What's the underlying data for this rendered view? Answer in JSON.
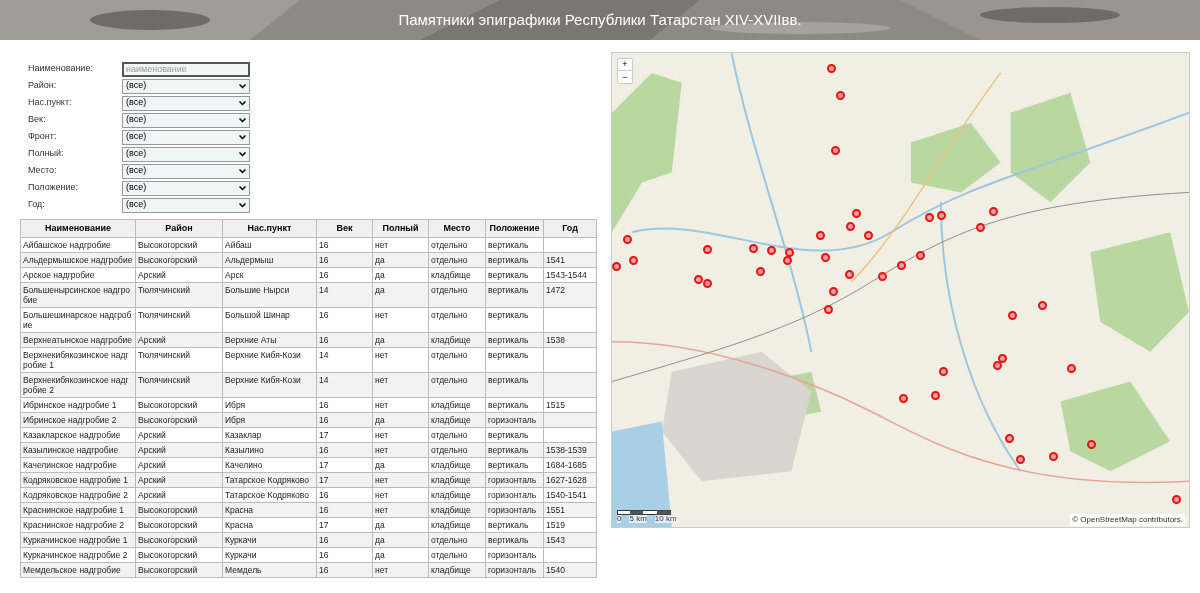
{
  "header": {
    "title": "Памятники эпиграфики Республики Татарстан XIV-XVIIвв."
  },
  "filters": [
    {
      "label": "Наименование:",
      "kind": "text",
      "placeholder": "наименование"
    },
    {
      "label": "Район:",
      "kind": "select",
      "value": "(все)"
    },
    {
      "label": "Нас.пункт:",
      "kind": "select",
      "value": "(все)"
    },
    {
      "label": "Век:",
      "kind": "select",
      "value": "(все)"
    },
    {
      "label": "Фронт:",
      "kind": "select",
      "value": "(все)"
    },
    {
      "label": "Полный:",
      "kind": "select",
      "value": "(все)"
    },
    {
      "label": "Место:",
      "kind": "select",
      "value": "(все)"
    },
    {
      "label": "Положение:",
      "kind": "select",
      "value": "(все)"
    },
    {
      "label": "Год:",
      "kind": "select",
      "value": "(все)"
    }
  ],
  "table": {
    "columns": [
      "Наименование",
      "Район",
      "Нас.пункт",
      "Век",
      "Полный",
      "Место",
      "Положение",
      "Год"
    ],
    "rows": [
      [
        "Айбашское надгробие",
        "Высокогорский",
        "Айбаш",
        "16",
        "нет",
        "отдельно",
        "вертикаль",
        ""
      ],
      [
        "Альдермышское надгробие",
        "Высокогорский",
        "Альдермыш",
        "16",
        "да",
        "отдельно",
        "вертикаль",
        "1541"
      ],
      [
        "Арское надгробие",
        "Арский",
        "Арск",
        "16",
        "да",
        "кладбище",
        "вертикаль",
        "1543-1544"
      ],
      [
        "Большенырсинское надгробие",
        "Тюлячинский",
        "Большие Нырси",
        "14",
        "да",
        "отдельно",
        "вертикаль",
        "1472"
      ],
      [
        "Большешинарское надгробие",
        "Тюлячинский",
        "Большой Шинар",
        "16",
        "нет",
        "отдельно",
        "вертикаль",
        ""
      ],
      [
        "Верхнеатынское надгробие",
        "Арский",
        "Верхние Аты",
        "16",
        "да",
        "кладбище",
        "вертикаль",
        "1538"
      ],
      [
        "Верхнекибякозинское надгробие 1",
        "Тюлячинский",
        "Верхние Кибя-Кози",
        "14",
        "нет",
        "отдельно",
        "вертикаль",
        ""
      ],
      [
        "Верхнекибякозинское надгробие 2",
        "Тюлячинский",
        "Верхние Кибя-Кози",
        "14",
        "нет",
        "отдельно",
        "вертикаль",
        ""
      ],
      [
        "Ибринское надгробие 1",
        "Высокогорский",
        "Ибря",
        "16",
        "нет",
        "кладбище",
        "вертикаль",
        "1515"
      ],
      [
        "Ибринское надгробие 2",
        "Высокогорский",
        "Ибря",
        "16",
        "да",
        "кладбище",
        "горизонталь",
        ""
      ],
      [
        "Казакларское надгробие",
        "Арский",
        "Казаклар",
        "17",
        "нет",
        "отдельно",
        "вертикаль",
        ""
      ],
      [
        "Казылинское надгробие",
        "Арский",
        "Казылино",
        "16",
        "нет",
        "отдельно",
        "вертикаль",
        "1538-1539"
      ],
      [
        "Качелинское надгробие",
        "Арский",
        "Качелино",
        "17",
        "да",
        "кладбище",
        "вертикаль",
        "1684-1685"
      ],
      [
        "Кодряковское надгробие 1",
        "Арский",
        "Татарское Кодряково",
        "17",
        "нет",
        "кладбище",
        "горизонталь",
        "1627-1628"
      ],
      [
        "Кодряковское надгробие 2",
        "Арский",
        "Татарское Кодряково",
        "16",
        "нет",
        "кладбище",
        "горизонталь",
        "1540-1541"
      ],
      [
        "Краснинское надгробие 1",
        "Высокогорский",
        "Красна",
        "16",
        "нет",
        "кладбище",
        "горизонталь",
        "1551"
      ],
      [
        "Краснинское надгробие 2",
        "Высокогорский",
        "Красна",
        "17",
        "да",
        "кладбище",
        "вертикаль",
        "1519"
      ],
      [
        "Куркачинское надгробие 1",
        "Высокогорский",
        "Куркачи",
        "16",
        "да",
        "отдельно",
        "вертикаль",
        "1543"
      ],
      [
        "Куркачинское надгробие 2",
        "Высокогорский",
        "Куркачи",
        "16",
        "да",
        "отдельно",
        "горизонталь",
        ""
      ],
      [
        "Мемдельское надгробие",
        "Высокогорский",
        "Мемдель",
        "16",
        "нет",
        "кладбище",
        "горизонталь",
        "1540"
      ]
    ]
  },
  "map": {
    "zoom_in": "+",
    "zoom_out": "−",
    "scale_labels": [
      "0",
      "5 km",
      "10 km"
    ],
    "attribution": "© OpenStreetMap contributors."
  }
}
